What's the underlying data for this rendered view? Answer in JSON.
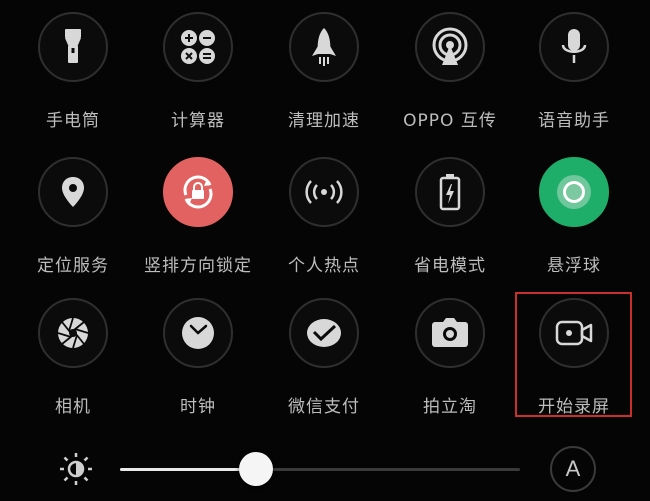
{
  "tiles": [
    {
      "label": "手电筒",
      "icon": "flashlight-icon"
    },
    {
      "label": "计算器",
      "icon": "calculator-icon"
    },
    {
      "label": "清理加速",
      "icon": "rocket-icon"
    },
    {
      "label": "OPPO 互传",
      "icon": "share-signal-icon"
    },
    {
      "label": "语音助手",
      "icon": "microphone-icon"
    },
    {
      "label": "定位服务",
      "icon": "location-pin-icon"
    },
    {
      "label": "竖排方向锁定",
      "icon": "rotation-lock-icon",
      "state": "active",
      "color": "#e26262"
    },
    {
      "label": "个人热点",
      "icon": "hotspot-icon"
    },
    {
      "label": "省电模式",
      "icon": "battery-saver-icon"
    },
    {
      "label": "悬浮球",
      "icon": "floating-ball-icon",
      "state": "active",
      "color": "#1fae6a"
    },
    {
      "label": "相机",
      "icon": "camera-aperture-icon"
    },
    {
      "label": "时钟",
      "icon": "clock-icon"
    },
    {
      "label": "微信支付",
      "icon": "wechat-pay-icon"
    },
    {
      "label": "拍立淘",
      "icon": "camera-icon"
    },
    {
      "label": "开始录屏",
      "icon": "screen-record-icon",
      "highlighted": true
    }
  ],
  "brightness": {
    "icon": "brightness-icon",
    "level": 0.34,
    "auto_label": "A"
  },
  "colors": {
    "background": "#050505",
    "highlight_border": "#c9302c"
  }
}
